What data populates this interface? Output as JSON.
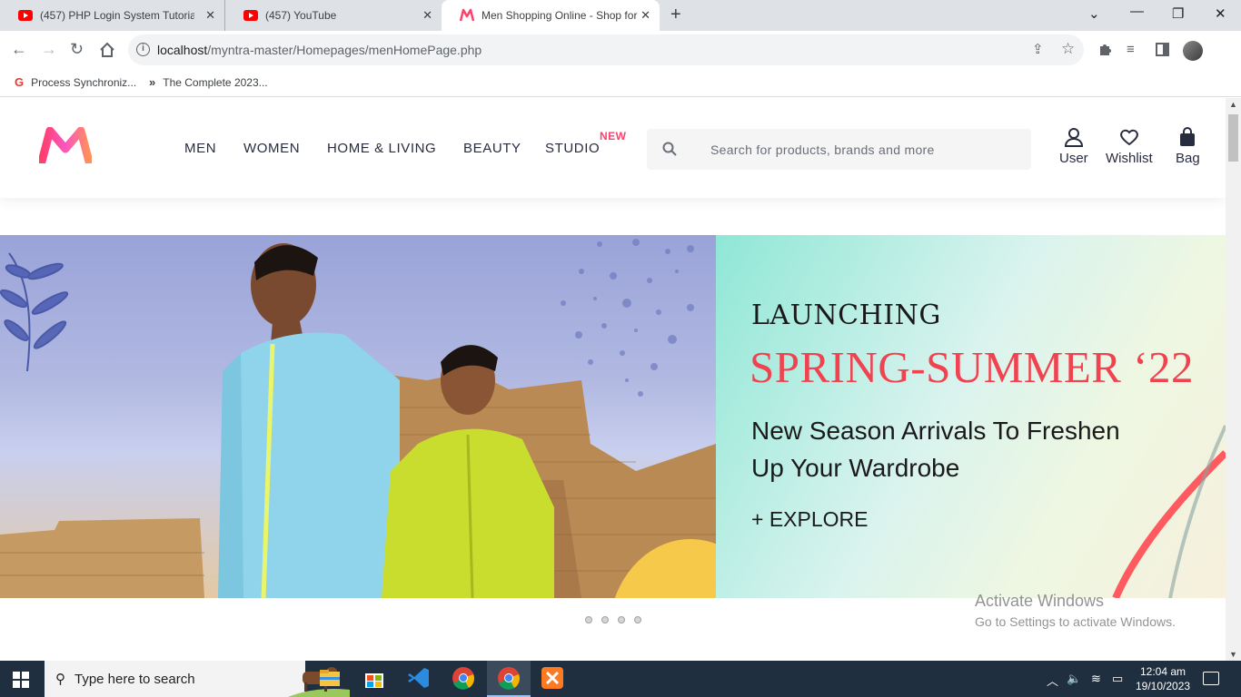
{
  "browser": {
    "tabs": [
      {
        "title": "(457) PHP Login System Tutorial",
        "favicon": "youtube-icon"
      },
      {
        "title": "(457) YouTube",
        "favicon": "youtube-icon"
      },
      {
        "title": "Men Shopping Online - Shop for",
        "favicon": "myntra-icon"
      }
    ],
    "new_tab": "+",
    "url_host": "localhost",
    "url_path": "/myntra-master/Homepages/menHomePage.php",
    "bookmarks": [
      {
        "label": "Process Synchroniz...",
        "icon": "g-icon"
      },
      {
        "label": "The Complete 2023...",
        "icon": "chevron-icon"
      }
    ]
  },
  "site": {
    "nav": [
      "MEN",
      "WOMEN",
      "HOME & LIVING",
      "BEAUTY",
      "STUDIO"
    ],
    "new_badge": "NEW",
    "search_placeholder": "Search for products, brands and more",
    "actions": [
      "User",
      "Wishlist",
      "Bag"
    ],
    "brand_color": "#ff3f6c"
  },
  "banner": {
    "line1": "LAUNCHING",
    "line2": "SPRING-SUMMER ‘22",
    "tagline_1": "New Season Arrivals To Freshen",
    "tagline_2": "Up Your Wardrobe",
    "cta": "+ EXPLORE",
    "slide_count": 4
  },
  "watermark": {
    "title": "Activate Windows",
    "subtitle": "Go to Settings to activate Windows."
  },
  "taskbar": {
    "search_placeholder": "Type here to search",
    "time": "12:04 am",
    "date": "19/10/2023"
  }
}
